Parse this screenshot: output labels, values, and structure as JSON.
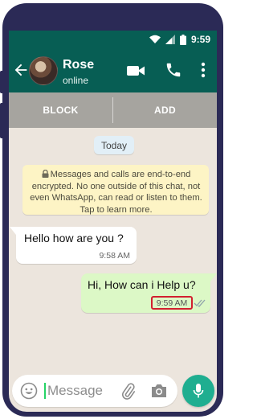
{
  "status_bar": {
    "time": "9:59"
  },
  "header": {
    "name": "Rose",
    "status": "online"
  },
  "action_bar": {
    "block_label": "BLOCK",
    "add_label": "ADD"
  },
  "date_chip": "Today",
  "encryption_notice": "Messages and calls are end-to-end encrypted. No one outside of this chat, not even WhatsApp, can read or listen to them. Tap to learn more.",
  "messages": [
    {
      "direction": "incoming",
      "text": "Hello how are you ?",
      "time": "9:58 AM"
    },
    {
      "direction": "outgoing",
      "text": "Hi, How can i Help u?",
      "time": "9:59 AM"
    }
  ],
  "composer": {
    "placeholder": "Message"
  },
  "colors": {
    "header": "#075e54",
    "outgoing_bubble": "#dcf8c6",
    "mic_button": "#1fae90",
    "time_highlight_border": "#d2202f",
    "phone_frame": "#2b2a56"
  },
  "icons": [
    "arrow-left-icon",
    "video-icon",
    "phone-icon",
    "more-vert-icon",
    "lock-icon",
    "double-tick-icon",
    "emoji-icon",
    "paperclip-icon",
    "camera-icon",
    "mic-icon",
    "wifi-icon",
    "signal-icon",
    "battery-icon"
  ]
}
